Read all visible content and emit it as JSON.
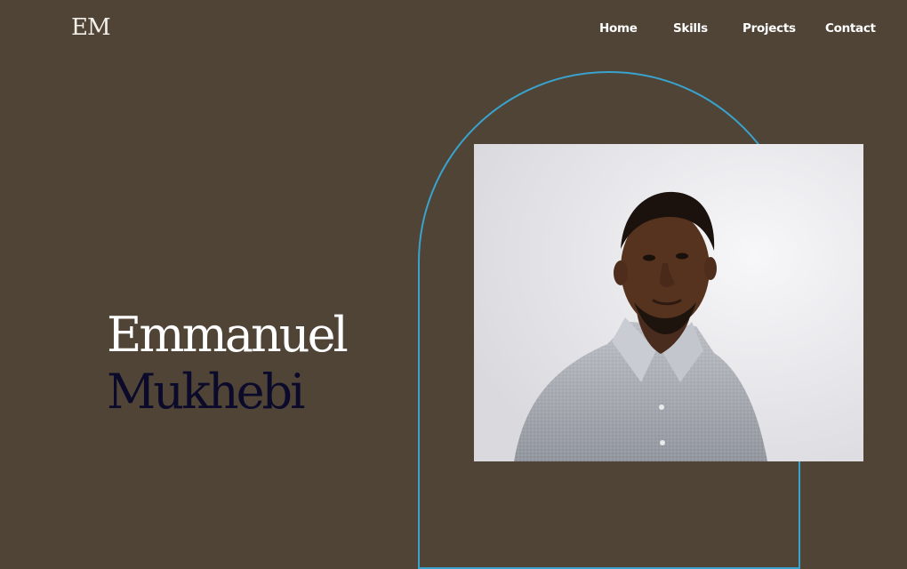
{
  "brand": {
    "logo_text": "EM"
  },
  "nav": {
    "items": [
      {
        "label": "Home"
      },
      {
        "label": "Skills"
      },
      {
        "label": "Projects"
      },
      {
        "label": "Contact"
      }
    ]
  },
  "hero": {
    "first_name": "Emmanuel",
    "last_name": "Mukhebi",
    "portrait_description_icon": "person-portrait"
  },
  "colors": {
    "background": "#4f4436",
    "arch_outline": "#3aa3cd",
    "first_name_text": "#ffffff",
    "last_name_text": "#0b0a2b",
    "nav_text": "#ffffff"
  }
}
